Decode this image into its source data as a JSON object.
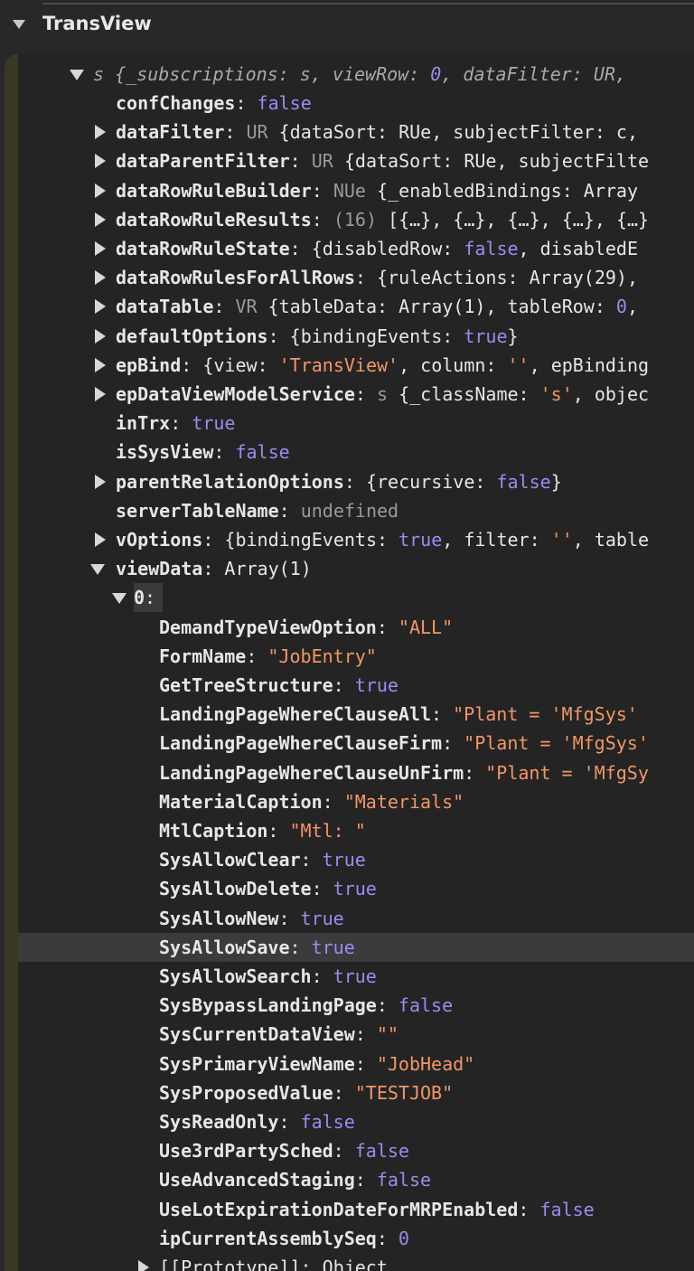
{
  "panel": {
    "title": "TransView"
  },
  "object": {
    "summary_prefix": "s ",
    "summary": "{_subscriptions: s, viewRow: ",
    "summary_num": "0",
    "summary_tail": ", dataFilter: UR,"
  },
  "props": [
    {
      "key": "confChanges",
      "cls": "",
      "value": "false",
      "type": "bool",
      "expandable": false
    },
    {
      "key": "dataFilter",
      "cls": "UR ",
      "value": "{dataSort: RUe, subjectFilter: c,",
      "type": "txt",
      "expandable": true
    },
    {
      "key": "dataParentFilter",
      "cls": "UR ",
      "value": "{dataSort: RUe, subjectFilte",
      "type": "txt",
      "expandable": true
    },
    {
      "key": "dataRowRuleBuilder",
      "cls": "NUe ",
      "value": "{_enabledBindings: Array",
      "type": "txt",
      "expandable": true
    },
    {
      "key": "dataRowRuleResults",
      "cls": "(16) ",
      "value": "[{…}, {…}, {…}, {…}, {…}",
      "type": "txt",
      "expandable": true
    },
    {
      "key": "dataRowRuleState",
      "cls": "",
      "value_parts": [
        [
          "{disabledRow: ",
          "txt"
        ],
        [
          "false",
          "bool"
        ],
        [
          ", disabledE",
          "txt"
        ]
      ],
      "expandable": true
    },
    {
      "key": "dataRowRulesForAllRows",
      "cls": "",
      "value": "{ruleActions: Array(29),",
      "type": "txt",
      "expandable": true
    },
    {
      "key": "dataTable",
      "cls": "VR ",
      "value_parts": [
        [
          "{tableData: Array(1), tableRow: ",
          "txt"
        ],
        [
          "0",
          "num"
        ],
        [
          ",",
          "txt"
        ]
      ],
      "expandable": true
    },
    {
      "key": "defaultOptions",
      "cls": "",
      "value_parts": [
        [
          "{bindingEvents: ",
          "txt"
        ],
        [
          "true",
          "bool"
        ],
        [
          "}",
          "txt"
        ]
      ],
      "expandable": true
    },
    {
      "key": "epBind",
      "cls": "",
      "value_parts": [
        [
          "{view: ",
          "txt"
        ],
        [
          "'TransView'",
          "str"
        ],
        [
          ", column: ",
          "txt"
        ],
        [
          "''",
          "str"
        ],
        [
          ", epBinding",
          "txt"
        ]
      ],
      "expandable": true
    },
    {
      "key": "epDataViewModelService",
      "cls": "s ",
      "value_parts": [
        [
          "{_className: ",
          "txt"
        ],
        [
          "'s'",
          "str"
        ],
        [
          ", objec",
          "txt"
        ]
      ],
      "expandable": true
    },
    {
      "key": "inTrx",
      "cls": "",
      "value": "true",
      "type": "bool",
      "expandable": false
    },
    {
      "key": "isSysView",
      "cls": "",
      "value": "false",
      "type": "bool",
      "expandable": false
    },
    {
      "key": "parentRelationOptions",
      "cls": "",
      "value_parts": [
        [
          "{recursive: ",
          "txt"
        ],
        [
          "false",
          "bool"
        ],
        [
          "}",
          "txt"
        ]
      ],
      "expandable": true
    },
    {
      "key": "serverTableName",
      "cls": "",
      "value": "undefined",
      "type": "undef",
      "expandable": false
    },
    {
      "key": "vOptions",
      "cls": "",
      "value_parts": [
        [
          "{bindingEvents: ",
          "txt"
        ],
        [
          "true",
          "bool"
        ],
        [
          ", filter: ",
          "txt"
        ],
        [
          "''",
          "str"
        ],
        [
          ", table",
          "txt"
        ]
      ],
      "expandable": true
    },
    {
      "key": "viewData",
      "cls": "",
      "value": "Array(1)",
      "type": "txt",
      "expandable": true,
      "open": true
    }
  ],
  "array_index": "0",
  "items": [
    {
      "key": "DemandTypeViewOption",
      "value": "\"ALL\"",
      "type": "str"
    },
    {
      "key": "FormName",
      "value": "\"JobEntry\"",
      "type": "str"
    },
    {
      "key": "GetTreeStructure",
      "value": "true",
      "type": "bool"
    },
    {
      "key": "LandingPageWhereClauseAll",
      "value": "\"Plant = 'MfgSys'",
      "type": "str"
    },
    {
      "key": "LandingPageWhereClauseFirm",
      "value": "\"Plant = 'MfgSys'",
      "type": "str"
    },
    {
      "key": "LandingPageWhereClauseUnFirm",
      "value": "\"Plant = 'MfgSy",
      "type": "str"
    },
    {
      "key": "MaterialCaption",
      "value": "\"Materials\"",
      "type": "str"
    },
    {
      "key": "MtlCaption",
      "value": "\"Mtl: \"",
      "type": "str"
    },
    {
      "key": "SysAllowClear",
      "value": "true",
      "type": "bool"
    },
    {
      "key": "SysAllowDelete",
      "value": "true",
      "type": "bool"
    },
    {
      "key": "SysAllowNew",
      "value": "true",
      "type": "bool"
    },
    {
      "key": "SysAllowSave",
      "value": "true",
      "type": "bool",
      "highlighted": true
    },
    {
      "key": "SysAllowSearch",
      "value": "true",
      "type": "bool"
    },
    {
      "key": "SysBypassLandingPage",
      "value": "false",
      "type": "bool"
    },
    {
      "key": "SysCurrentDataView",
      "value": "\"\"",
      "type": "str"
    },
    {
      "key": "SysPrimaryViewName",
      "value": "\"JobHead\"",
      "type": "str"
    },
    {
      "key": "SysProposedValue",
      "value": "\"TESTJOB\"",
      "type": "str"
    },
    {
      "key": "SysReadOnly",
      "value": "false",
      "type": "bool"
    },
    {
      "key": "Use3rdPartySched",
      "value": "false",
      "type": "bool"
    },
    {
      "key": "UseAdvancedStaging",
      "value": "false",
      "type": "bool"
    },
    {
      "key": "UseLotExpirationDateForMRPEnabled",
      "value": "false",
      "type": "bool"
    },
    {
      "key": "ipCurrentAssemblySeq",
      "value": "0",
      "type": "num"
    }
  ],
  "prototype": {
    "key": "[[Prototype]]",
    "value": "Object"
  }
}
